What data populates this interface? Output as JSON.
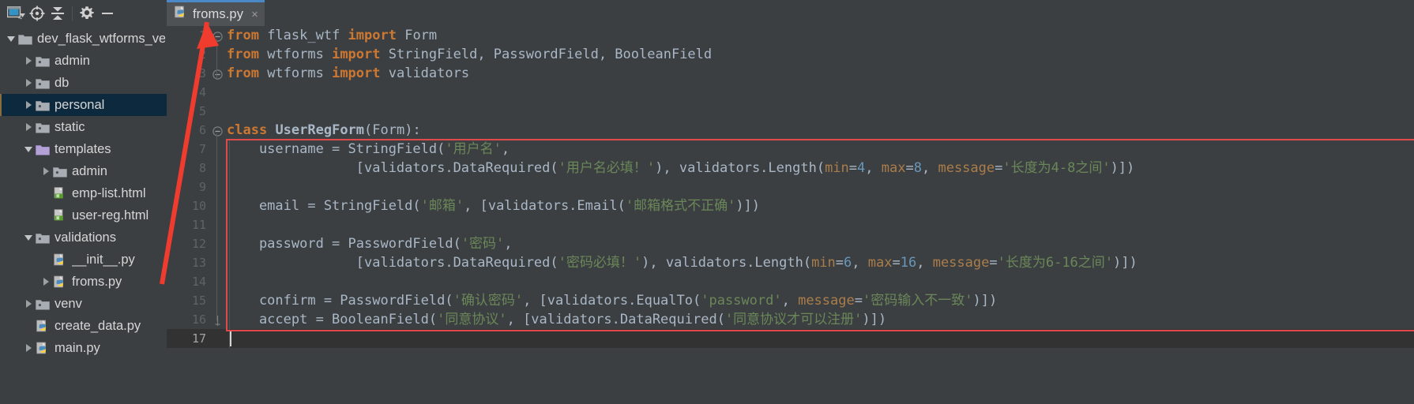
{
  "window": {
    "toolbar": [
      {
        "name": "project-view-selector",
        "icon": "window-dropdown-icon",
        "label": "Project View"
      },
      {
        "name": "locate-icon",
        "icon": "crosshair-icon",
        "label": "Select Opened File"
      },
      {
        "name": "collapse-all-icon",
        "icon": "collapse-all-icon",
        "label": "Collapse All"
      },
      {
        "name": "settings-icon",
        "icon": "gear-icon",
        "label": "Settings"
      },
      {
        "name": "hide-icon",
        "icon": "minus-icon",
        "label": "Hide"
      }
    ]
  },
  "tabs": [
    {
      "label": "froms.py",
      "icon": "python-file-icon",
      "close": "×",
      "active": true
    }
  ],
  "tree": {
    "items": [
      {
        "label": "dev_flask_wtforms_ve",
        "depth": 0,
        "arrow": "down",
        "icon": "folder-icon",
        "selected": false
      },
      {
        "label": "admin",
        "depth": 1,
        "arrow": "right",
        "icon": "folder-src-icon",
        "selected": false
      },
      {
        "label": "db",
        "depth": 1,
        "arrow": "right",
        "icon": "folder-src-icon",
        "selected": false
      },
      {
        "label": "personal",
        "depth": 1,
        "arrow": "right",
        "icon": "folder-src-icon",
        "selected": true
      },
      {
        "label": "static",
        "depth": 1,
        "arrow": "right",
        "icon": "folder-src-icon",
        "selected": false
      },
      {
        "label": "templates",
        "depth": 1,
        "arrow": "down",
        "icon": "folder-templates-icon",
        "selected": false
      },
      {
        "label": "admin",
        "depth": 2,
        "arrow": "right",
        "icon": "folder-src-icon",
        "selected": false
      },
      {
        "label": "emp-list.html",
        "depth": 2,
        "arrow": "none",
        "icon": "html-file-icon",
        "selected": false
      },
      {
        "label": "user-reg.html",
        "depth": 2,
        "arrow": "none",
        "icon": "html-file-icon",
        "selected": false
      },
      {
        "label": "validations",
        "depth": 1,
        "arrow": "down",
        "icon": "folder-src-icon",
        "selected": false
      },
      {
        "label": "__init__.py",
        "depth": 2,
        "arrow": "none",
        "icon": "python-file-icon",
        "selected": false
      },
      {
        "label": "froms.py",
        "depth": 2,
        "arrow": "right",
        "icon": "python-file-icon",
        "selected": false
      },
      {
        "label": "venv",
        "depth": 1,
        "arrow": "right",
        "icon": "folder-src-icon",
        "selected": false
      },
      {
        "label": "create_data.py",
        "depth": 1,
        "arrow": "none",
        "icon": "python-file-icon",
        "selected": false
      },
      {
        "label": "main.py",
        "depth": 1,
        "arrow": "right",
        "icon": "python-file-icon",
        "selected": false
      }
    ]
  },
  "editor": {
    "line_numbers": [
      "1",
      "2",
      "3",
      "4",
      "5",
      "6",
      "7",
      "8",
      "9",
      "10",
      "11",
      "12",
      "13",
      "14",
      "15",
      "16",
      "17"
    ],
    "current_line": 17,
    "lines": [
      [
        {
          "t": "from",
          "c": "kw"
        },
        {
          "t": " flask_wtf ",
          "c": "txt"
        },
        {
          "t": "import",
          "c": "kw"
        },
        {
          "t": " Form",
          "c": "txt"
        }
      ],
      [
        {
          "t": "from",
          "c": "kw"
        },
        {
          "t": " wtforms ",
          "c": "txt"
        },
        {
          "t": "import",
          "c": "kw"
        },
        {
          "t": " StringField, PasswordField, BooleanField",
          "c": "txt"
        }
      ],
      [
        {
          "t": "from",
          "c": "kw"
        },
        {
          "t": " wtforms ",
          "c": "txt"
        },
        {
          "t": "import",
          "c": "kw"
        },
        {
          "t": " validators",
          "c": "txt"
        }
      ],
      [],
      [],
      [
        {
          "t": "class",
          "c": "kw"
        },
        {
          "t": " ",
          "c": "txt"
        },
        {
          "t": "UserRegForm",
          "c": "cls"
        },
        {
          "t": "(Form):",
          "c": "txt"
        }
      ],
      [
        {
          "t": "    username = StringField(",
          "c": "txt"
        },
        {
          "t": "'用户名'",
          "c": "str"
        },
        {
          "t": ",",
          "c": "txt"
        }
      ],
      [
        {
          "t": "                [validators.DataRequired(",
          "c": "txt"
        },
        {
          "t": "'用户名必填！'",
          "c": "str"
        },
        {
          "t": "), validators.Length(",
          "c": "txt"
        },
        {
          "t": "min",
          "c": "kwarg"
        },
        {
          "t": "=",
          "c": "txt"
        },
        {
          "t": "4",
          "c": "num"
        },
        {
          "t": ", ",
          "c": "txt"
        },
        {
          "t": "max",
          "c": "kwarg"
        },
        {
          "t": "=",
          "c": "txt"
        },
        {
          "t": "8",
          "c": "num"
        },
        {
          "t": ", ",
          "c": "txt"
        },
        {
          "t": "message",
          "c": "kwarg"
        },
        {
          "t": "=",
          "c": "txt"
        },
        {
          "t": "'长度为4-8之间'",
          "c": "str"
        },
        {
          "t": ")])",
          "c": "txt"
        }
      ],
      [],
      [
        {
          "t": "    email = StringField(",
          "c": "txt"
        },
        {
          "t": "'邮箱'",
          "c": "str"
        },
        {
          "t": ", [validators.Email(",
          "c": "txt"
        },
        {
          "t": "'邮箱格式不正确'",
          "c": "str"
        },
        {
          "t": ")])",
          "c": "txt"
        }
      ],
      [],
      [
        {
          "t": "    password = PasswordField(",
          "c": "txt"
        },
        {
          "t": "'密码'",
          "c": "str"
        },
        {
          "t": ",",
          "c": "txt"
        }
      ],
      [
        {
          "t": "                [validators.DataRequired(",
          "c": "txt"
        },
        {
          "t": "'密码必填！'",
          "c": "str"
        },
        {
          "t": "), validators.Length(",
          "c": "txt"
        },
        {
          "t": "min",
          "c": "kwarg"
        },
        {
          "t": "=",
          "c": "txt"
        },
        {
          "t": "6",
          "c": "num"
        },
        {
          "t": ", ",
          "c": "txt"
        },
        {
          "t": "max",
          "c": "kwarg"
        },
        {
          "t": "=",
          "c": "txt"
        },
        {
          "t": "16",
          "c": "num"
        },
        {
          "t": ", ",
          "c": "txt"
        },
        {
          "t": "message",
          "c": "kwarg"
        },
        {
          "t": "=",
          "c": "txt"
        },
        {
          "t": "'长度为6-16之间'",
          "c": "str"
        },
        {
          "t": ")])",
          "c": "txt"
        }
      ],
      [],
      [
        {
          "t": "    confirm = PasswordField(",
          "c": "txt"
        },
        {
          "t": "'确认密码'",
          "c": "str"
        },
        {
          "t": ", [validators.EqualTo(",
          "c": "txt"
        },
        {
          "t": "'password'",
          "c": "str"
        },
        {
          "t": ", ",
          "c": "txt"
        },
        {
          "t": "message",
          "c": "kwarg"
        },
        {
          "t": "=",
          "c": "txt"
        },
        {
          "t": "'密码输入不一致'",
          "c": "str"
        },
        {
          "t": ")])",
          "c": "txt"
        }
      ],
      [
        {
          "t": "    accept = BooleanField(",
          "c": "txt"
        },
        {
          "t": "'同意协议'",
          "c": "str"
        },
        {
          "t": ", [validators.DataRequired(",
          "c": "txt"
        },
        {
          "t": "'同意协议才可以注册'",
          "c": "str"
        },
        {
          "t": ")])",
          "c": "txt"
        }
      ],
      []
    ]
  },
  "annotations": {
    "highlight_box_color": "#e04a4a",
    "arrow_color": "#f03c2e",
    "arrow_label": "points from froms.py tree node to froms.py editor tab"
  },
  "colors": {
    "background": "#3c3f41",
    "editor_background": "#3c3f41",
    "tab_active": "#4e5254",
    "tab_underline": "#4a88c7",
    "selection": "#0d293e",
    "keyword": "#cc7832",
    "string": "#6a8759",
    "number": "#6897bb",
    "text": "#a9b7c6",
    "gutter_text": "#606366"
  }
}
